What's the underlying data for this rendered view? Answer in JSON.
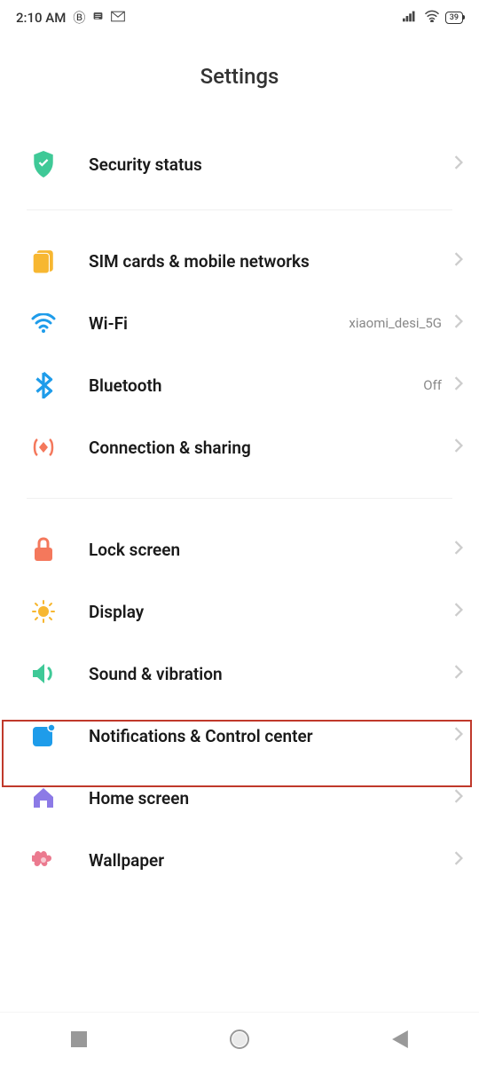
{
  "statusBar": {
    "time": "2:10 AM",
    "batteryLevel": "39"
  },
  "pageTitle": "Settings",
  "items": [
    {
      "id": "security-status",
      "label": "Security status"
    },
    {
      "id": "sim-cards",
      "label": "SIM cards & mobile networks"
    },
    {
      "id": "wifi",
      "label": "Wi-Fi",
      "value": "xiaomi_desi_5G"
    },
    {
      "id": "bluetooth",
      "label": "Bluetooth",
      "value": "Off"
    },
    {
      "id": "connection-sharing",
      "label": "Connection & sharing"
    },
    {
      "id": "lock-screen",
      "label": "Lock screen"
    },
    {
      "id": "display",
      "label": "Display"
    },
    {
      "id": "sound-vibration",
      "label": "Sound & vibration"
    },
    {
      "id": "notifications",
      "label": "Notifications & Control center"
    },
    {
      "id": "home-screen",
      "label": "Home screen"
    },
    {
      "id": "wallpaper",
      "label": "Wallpaper"
    }
  ]
}
